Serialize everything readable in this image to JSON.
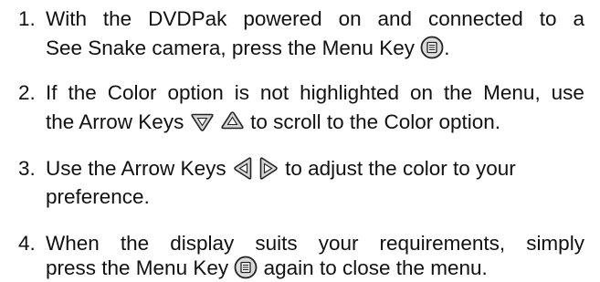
{
  "steps": [
    {
      "number": "1.",
      "lines": [
        {
          "words": [
            "With",
            "the",
            "DVDPak",
            "powered",
            "on",
            "and",
            "connected",
            "to",
            "a"
          ]
        },
        {
          "before": "See Snake camera, press the Menu Key",
          "after": "."
        }
      ],
      "icons": [
        "menu-key-icon"
      ]
    },
    {
      "number": "2.",
      "lines": [
        {
          "words": [
            "If",
            "the",
            "Color",
            "option",
            "is",
            "not",
            "highlighted",
            "on",
            "the",
            "Menu,",
            "use"
          ]
        },
        {
          "before": "the Arrow Keys",
          "after": "to scroll to the Color option."
        }
      ],
      "icons": [
        "arrow-down-key-icon",
        "arrow-up-key-icon"
      ]
    },
    {
      "number": "3.",
      "lines": [
        {
          "before": "Use the Arrow Keys",
          "after": "to adjust the color to your"
        },
        {
          "text": "preference."
        }
      ],
      "icons": [
        "arrow-left-key-icon",
        "arrow-right-key-icon"
      ]
    },
    {
      "number": "4.",
      "lines": [
        {
          "words": [
            "When",
            "the",
            "display",
            "suits",
            "your",
            "requirements,",
            "simply"
          ]
        },
        {
          "before": "press the Menu Key",
          "after": "again to close the menu."
        }
      ],
      "icons": [
        "menu-key-icon"
      ]
    }
  ]
}
